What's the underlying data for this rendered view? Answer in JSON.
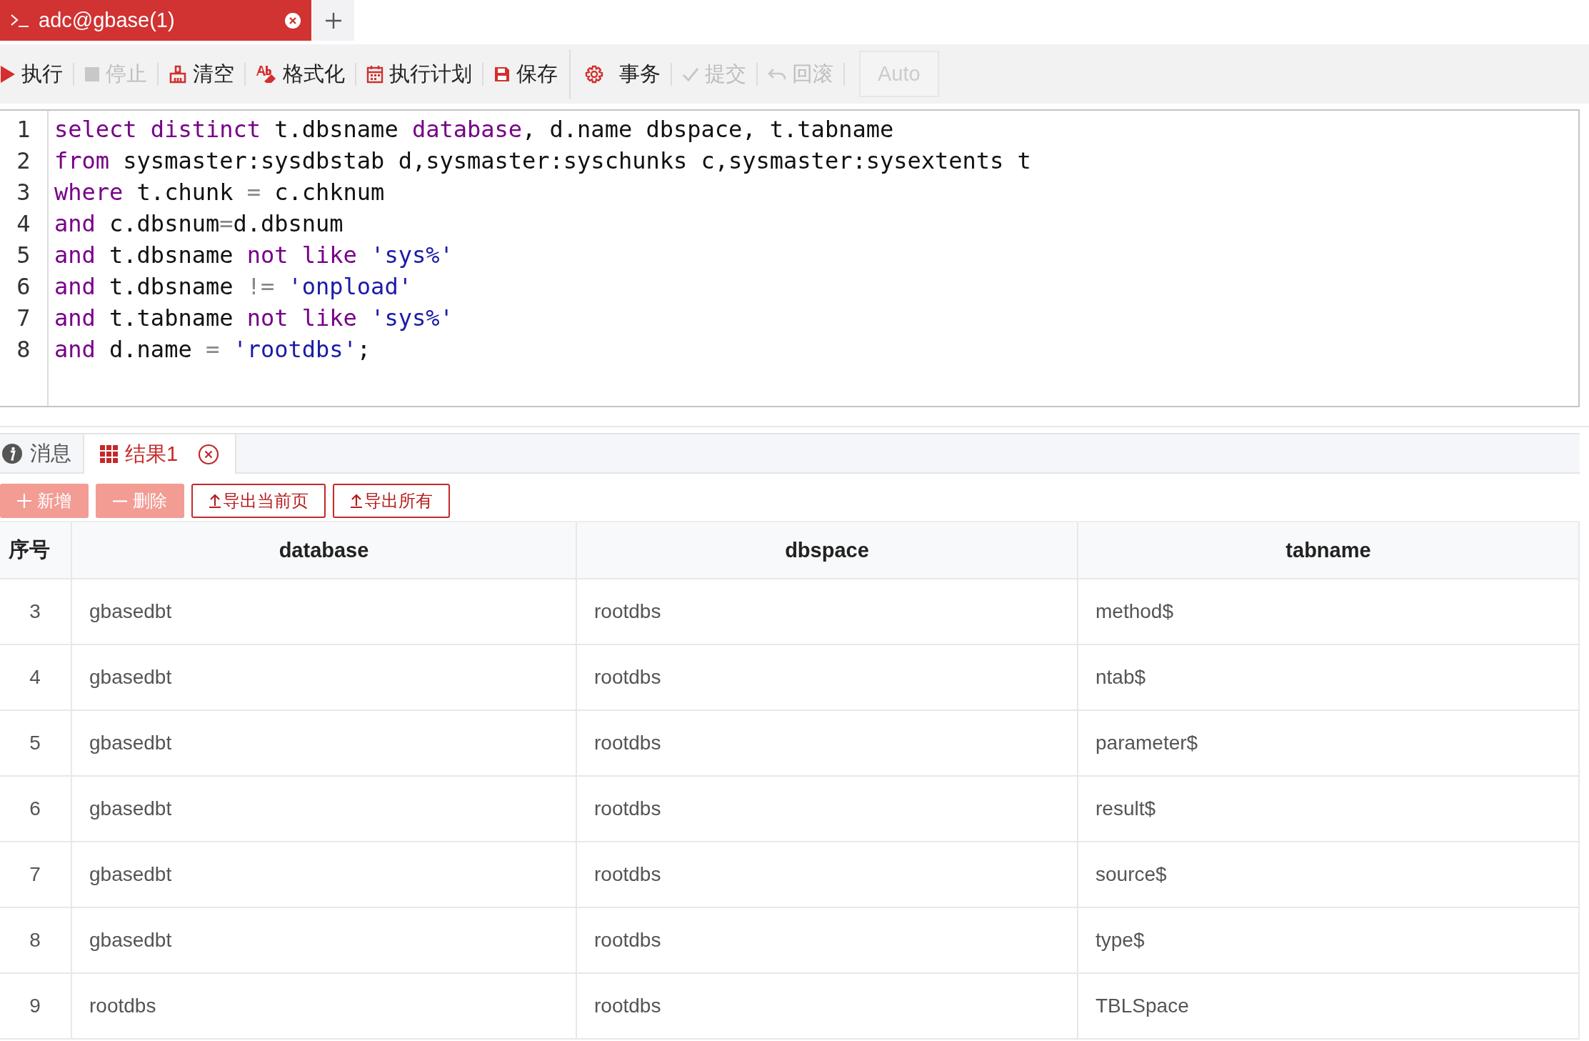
{
  "session_tabs": [
    {
      "title": "adc@gbase(1)",
      "selected": true
    }
  ],
  "toolbar": [
    {
      "kind": "run",
      "label": "执行",
      "disabled": false
    },
    {
      "kind": "stop",
      "label": "停止",
      "disabled": true
    },
    {
      "kind": "clear",
      "label": "清空",
      "disabled": false
    },
    {
      "kind": "format",
      "label": "格式化",
      "disabled": false
    },
    {
      "kind": "plan",
      "label": "执行计划",
      "disabled": false
    },
    {
      "kind": "save",
      "label": "保存",
      "disabled": false
    },
    {
      "kind": "transaction",
      "label": "事务",
      "disabled": false
    },
    {
      "kind": "commit",
      "label": "提交",
      "disabled": true
    },
    {
      "kind": "rollback",
      "label": "回滚",
      "disabled": true
    }
  ],
  "mode_button": {
    "label": "Auto",
    "disabled": true
  },
  "editor": {
    "lines": [
      {
        "number": "1",
        "tokens": [
          {
            "kind": "keyword",
            "text": "select"
          },
          {
            "kind": "keyword",
            "text": " distinct"
          },
          {
            "kind": "plain",
            "text": " t.dbsname "
          },
          {
            "kind": "keyword",
            "text": "database"
          },
          {
            "kind": "plain",
            "text": ", d.name dbspace, t.tabname"
          }
        ]
      },
      {
        "number": "2",
        "tokens": [
          {
            "kind": "keyword",
            "text": "from"
          },
          {
            "kind": "plain",
            "text": " sysmaster:sysdbstab d,sysmaster:syschunks c,sysmaster:sysextents t"
          }
        ]
      },
      {
        "number": "3",
        "tokens": [
          {
            "kind": "keyword",
            "text": "where"
          },
          {
            "kind": "plain",
            "text": " t.chunk "
          },
          {
            "kind": "operator",
            "text": "="
          },
          {
            "kind": "plain",
            "text": " c.chknum"
          }
        ]
      },
      {
        "number": "4",
        "tokens": [
          {
            "kind": "keyword",
            "text": "and"
          },
          {
            "kind": "plain",
            "text": " c.dbsnum"
          },
          {
            "kind": "operator",
            "text": "="
          },
          {
            "kind": "plain",
            "text": "d.dbsnum"
          }
        ]
      },
      {
        "number": "5",
        "tokens": [
          {
            "kind": "keyword",
            "text": "and"
          },
          {
            "kind": "plain",
            "text": " t.dbsname "
          },
          {
            "kind": "keyword",
            "text": "not"
          },
          {
            "kind": "keyword",
            "text": " like"
          },
          {
            "kind": "string",
            "text": " 'sys%'"
          }
        ]
      },
      {
        "number": "6",
        "tokens": [
          {
            "kind": "keyword",
            "text": "and"
          },
          {
            "kind": "plain",
            "text": " t.dbsname "
          },
          {
            "kind": "operator",
            "text": "!="
          },
          {
            "kind": "string",
            "text": " 'onpload'"
          }
        ]
      },
      {
        "number": "7",
        "tokens": [
          {
            "kind": "keyword",
            "text": "and"
          },
          {
            "kind": "plain",
            "text": " t.tabname "
          },
          {
            "kind": "keyword",
            "text": "not"
          },
          {
            "kind": "keyword",
            "text": " like"
          },
          {
            "kind": "string",
            "text": " 'sys%'"
          }
        ]
      },
      {
        "number": "8",
        "tokens": [
          {
            "kind": "keyword",
            "text": "and"
          },
          {
            "kind": "plain",
            "text": " d.name "
          },
          {
            "kind": "operator",
            "text": "="
          },
          {
            "kind": "string",
            "text": " 'rootdbs'"
          },
          {
            "kind": "plain",
            "text": ";"
          }
        ]
      }
    ]
  },
  "result_tabs": [
    {
      "kind": "info",
      "label": "消息",
      "selected": false,
      "closable": false
    },
    {
      "kind": "grid",
      "label": "结果1",
      "selected": true,
      "closable": true
    }
  ],
  "result_actions": [
    {
      "kind": "add",
      "label": "新增",
      "disabled": true
    },
    {
      "kind": "delete",
      "label": "删除",
      "disabled": true
    },
    {
      "kind": "export",
      "label": "导出当前页",
      "disabled": false
    },
    {
      "kind": "export",
      "label": "导出所有",
      "disabled": false
    }
  ],
  "table": {
    "columns": [
      "序号",
      "database",
      "dbspace",
      "tabname"
    ],
    "rows": [
      [
        "3",
        "gbasedbt",
        "rootdbs",
        "method$"
      ],
      [
        "4",
        "gbasedbt",
        "rootdbs",
        "ntab$"
      ],
      [
        "5",
        "gbasedbt",
        "rootdbs",
        "parameter$"
      ],
      [
        "6",
        "gbasedbt",
        "rootdbs",
        "result$"
      ],
      [
        "7",
        "gbasedbt",
        "rootdbs",
        "source$"
      ],
      [
        "8",
        "gbasedbt",
        "rootdbs",
        "type$"
      ],
      [
        "9",
        "rootdbs",
        "rootdbs",
        "TBLSpace"
      ]
    ]
  }
}
